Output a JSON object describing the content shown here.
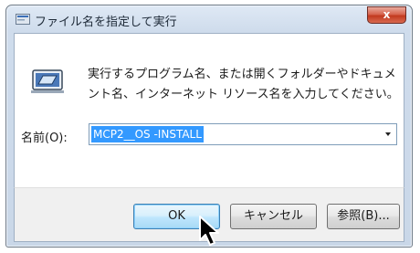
{
  "window": {
    "title": "ファイル名を指定して実行",
    "close_label": "x"
  },
  "body": {
    "description": "実行するプログラム名、または開くフォルダーやドキュメント名、インターネット リソース名を入力してください。",
    "open_label": "名前(O):",
    "open_value": "MCP2__OS -INSTALL"
  },
  "buttons": {
    "ok": "OK",
    "cancel": "キャンセル",
    "browse": "参照(B)..."
  },
  "colors": {
    "selection": "#3399ff",
    "close_button": "#c2391f",
    "frame": "#c9d7e8"
  },
  "icons": [
    "run-dialog-icon",
    "run-program-icon",
    "dropdown-arrow-icon",
    "mouse-pointer-icon"
  ]
}
